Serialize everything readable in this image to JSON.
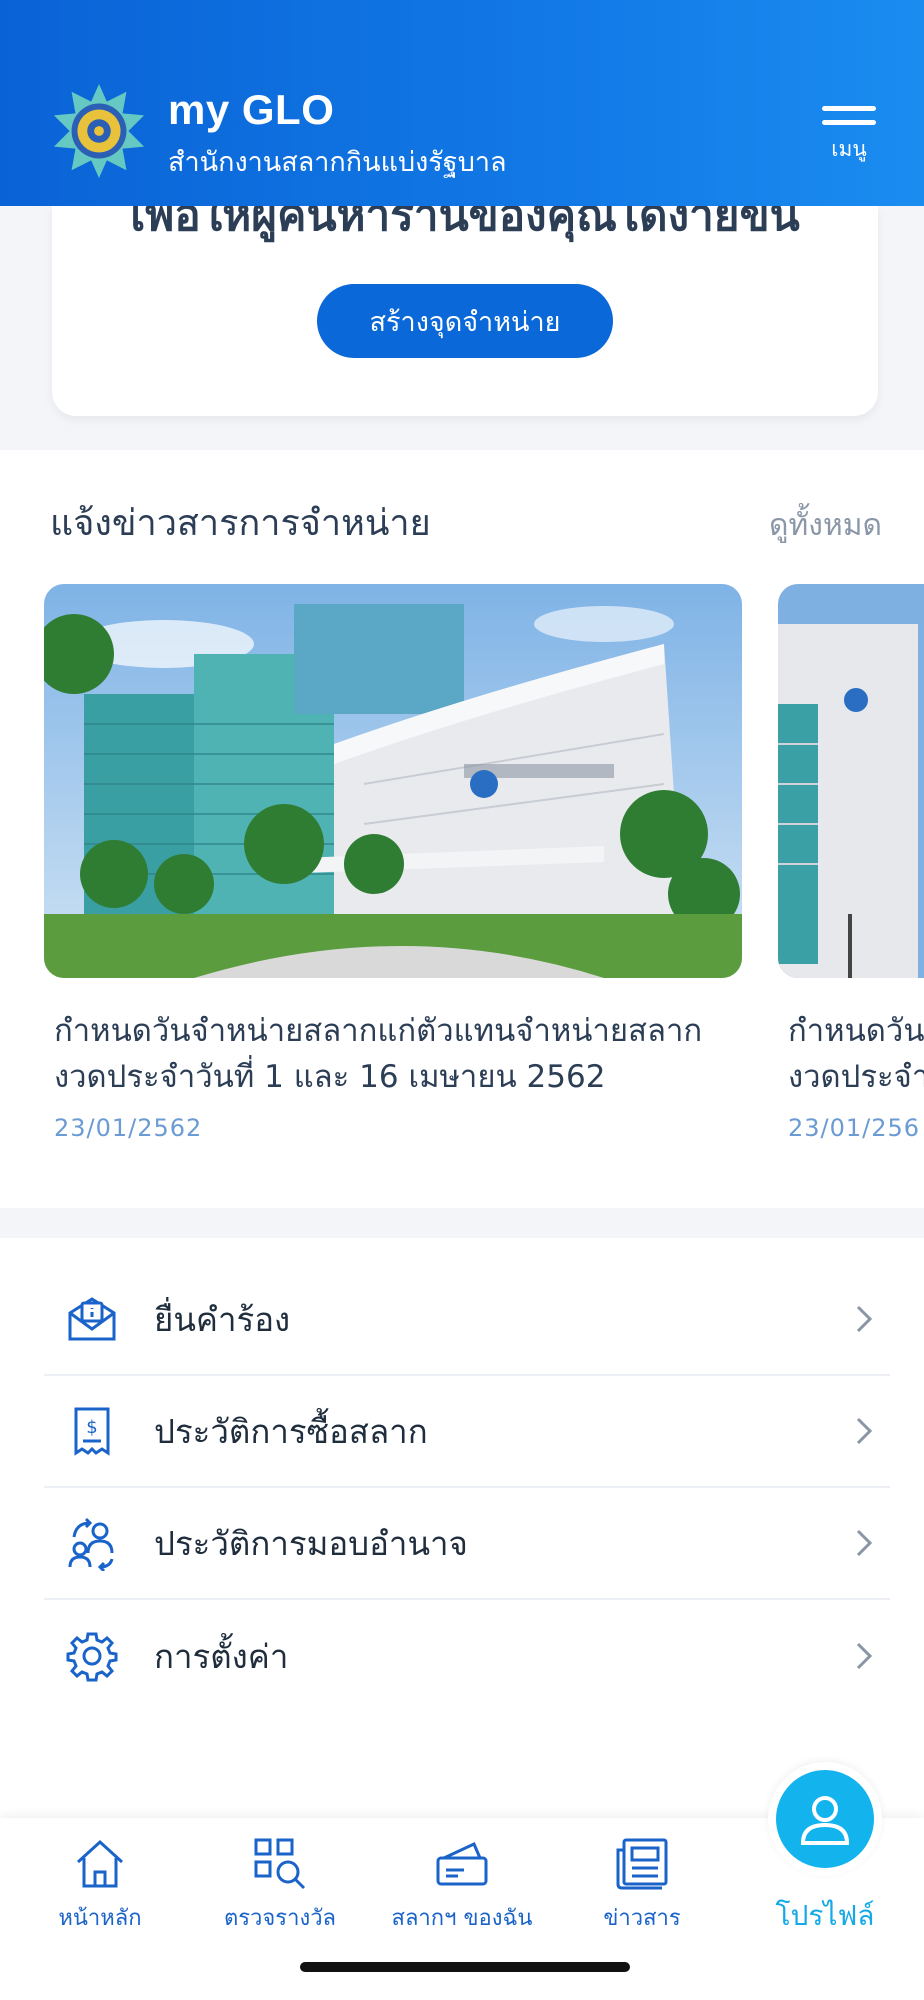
{
  "header": {
    "app_name": "my GLO",
    "app_subtitle": "สำนักงานสลากกินแบ่งรัฐบาล",
    "menu_label": "เมนู",
    "background_color": "#0a63d6"
  },
  "top_card": {
    "cut_text": "เพื่อให้ผู้คนหาร้านของคุณได้ง่ายขึ้น",
    "create_button_label": "สร้างจุดจำหน่าย"
  },
  "news": {
    "title": "แจ้งข่าวสารการจำหน่าย",
    "see_all_label": "ดูทั้งหมด",
    "items": [
      {
        "headline_line1": "กำหนดวันจำหน่ายสลากแก่ตัวแทนจำหน่ายสลาก",
        "headline_line2": "งวดประจำวันที่ 1 และ 16 เมษายน 2562",
        "date": "23/01/2562",
        "image": "glo-building-photo"
      },
      {
        "headline_line1": "กำหนดวัน",
        "headline_line2": "งวดประจำ",
        "date": "23/01/256",
        "image": "glo-tower-photo"
      }
    ]
  },
  "menu_list": [
    {
      "label": "ยื่นคำร้อง",
      "icon": "mail-info-icon"
    },
    {
      "label": "ประวัติการซื้อสลาก",
      "icon": "receipt-icon"
    },
    {
      "label": "ประวัติการมอบอำนาจ",
      "icon": "user-transfer-icon"
    },
    {
      "label": "การตั้งค่า",
      "icon": "gear-icon"
    }
  ],
  "bottom_nav": {
    "items": [
      {
        "label": "หน้าหลัก",
        "icon": "home-icon"
      },
      {
        "label": "ตรวจรางวัล",
        "icon": "qr-search-icon"
      },
      {
        "label": "สลากฯ ของฉัน",
        "icon": "ticket-icon"
      },
      {
        "label": "ข่าวสาร",
        "icon": "newspaper-icon"
      }
    ],
    "profile_label": "โปรไฟล์",
    "accent_color": "#13b4ee"
  }
}
